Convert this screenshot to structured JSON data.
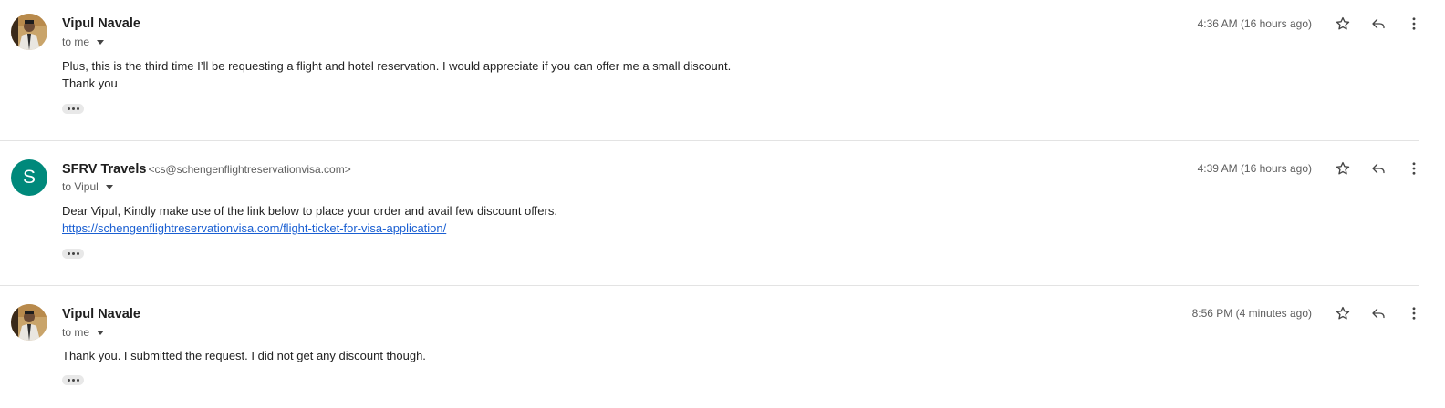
{
  "messages": [
    {
      "sender": "Vipul Navale",
      "email": "",
      "to": "to me",
      "time": "4:36 AM (16 hours ago)",
      "lines": [
        "Plus, this is the third time I’ll be requesting a flight and hotel reservation. I would appreciate if you can offer me a small discount.",
        "Thank you"
      ],
      "avatar": "photo"
    },
    {
      "sender": "SFRV Travels",
      "email": "<cs@schengenflightreservationvisa.com>",
      "to": "to Vipul",
      "time": "4:39 AM (16 hours ago)",
      "lines": [
        "Dear Vipul, Kindly make use of the link below to place your order and avail few discount offers."
      ],
      "link": "https://schengenflightreservationvisa.com/flight-ticket-for-visa-application/",
      "avatar": "S",
      "avatar_color": "#00897b"
    },
    {
      "sender": "Vipul Navale",
      "email": "",
      "to": "to me",
      "time": "8:56 PM (4 minutes ago)",
      "lines": [
        "Thank you. I submitted the request. I did not get any discount though."
      ],
      "avatar": "photo"
    }
  ],
  "icons": {
    "star": "star-icon",
    "reply": "reply-icon",
    "more": "more-vert-icon",
    "expand": "ellipsis-icon",
    "caret": "chevron-down-icon"
  }
}
